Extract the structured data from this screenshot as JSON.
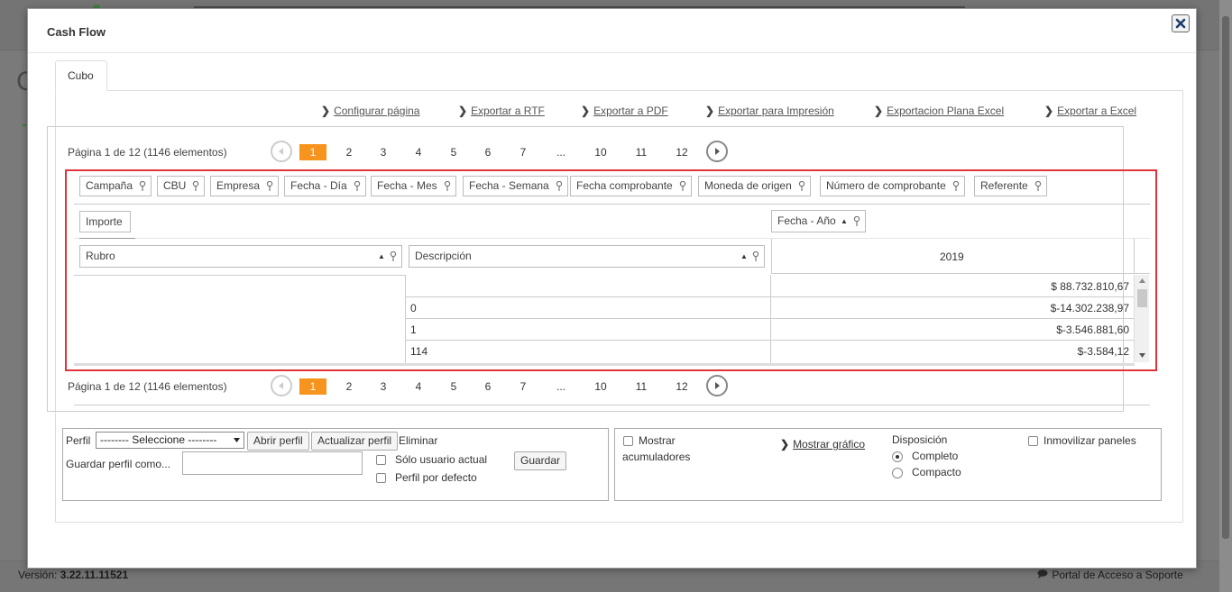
{
  "modal": {
    "title": "Cash Flow",
    "close_icon": "close-icon"
  },
  "tabs": [
    {
      "label": "Cubo"
    }
  ],
  "exports": [
    {
      "label": "Configurar página"
    },
    {
      "label": "Exportar a RTF"
    },
    {
      "label": "Exportar a PDF"
    },
    {
      "label": "Exportar para Impresión"
    },
    {
      "label": "Exportacion Plana Excel"
    },
    {
      "label": "Exportar a Excel"
    }
  ],
  "pager": {
    "summary": "Página 1 de 12 (1146 elementos)",
    "pages": [
      "1",
      "2",
      "3",
      "4",
      "5",
      "6",
      "7",
      "...",
      "10",
      "11",
      "12"
    ],
    "active_page": "1"
  },
  "filter_fields": [
    "Campaña",
    "CBU",
    "Empresa",
    "Fecha - Día",
    "Fecha - Mes",
    "Fecha - Semana",
    "Fecha comprobante",
    "Moneda de origen",
    "Número de comprobante",
    "Referente"
  ],
  "data_field": "Importe",
  "column_field": "Fecha - Año",
  "row_fields": [
    "Rubro",
    "Descripción"
  ],
  "column_header": "2019",
  "rows": [
    {
      "rubro": "",
      "descripcion": "",
      "value": "$ 88.732.810,67"
    },
    {
      "rubro": "",
      "descripcion": "0",
      "value": "$-14.302.238,97"
    },
    {
      "rubro": "",
      "descripcion": "1",
      "value": "$-3.546.881,60"
    },
    {
      "rubro": "",
      "descripcion": "114",
      "value": "$-3.584,12"
    }
  ],
  "profile": {
    "label": "Perfil",
    "select_value": "-------- Seleccione --------",
    "open_button": "Abrir perfil",
    "update_button": "Actualizar perfil",
    "delete_label": "Eliminar",
    "save_as_label": "Guardar perfil como...",
    "save_as_value": "",
    "only_current_user": "Sólo usuario actual",
    "default_profile": "Perfil por defecto",
    "save_button": "Guardar"
  },
  "options": {
    "show_accumulators_line1": "Mostrar",
    "show_accumulators_line2": "acumuladores",
    "show_chart": "Mostrar gráfico",
    "layout_label": "Disposición",
    "layout_options": [
      "Completo",
      "Compacto"
    ],
    "layout_selected": "Completo",
    "freeze_panels": "Inmovilizar paneles"
  },
  "footer": {
    "version_label": "Versión:",
    "version_value": "3.22.11.11521",
    "support_link": "Portal de Acceso a Soporte"
  },
  "colors": {
    "accent_page": "#f7941d",
    "highlight_border": "#e0343b"
  }
}
